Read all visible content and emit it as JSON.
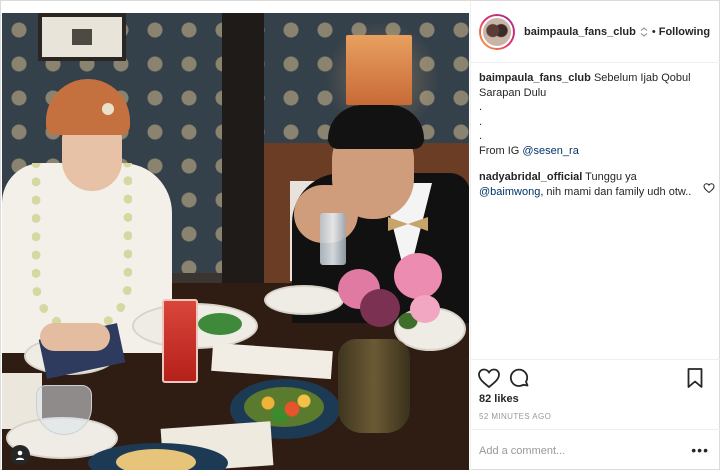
{
  "post": {
    "username": "baimpaula_fans_club",
    "header_dot": "•",
    "follow_label": "Following",
    "caption": {
      "username": "baimpaula_fans_club",
      "text": "Sebelum Ijab Qobul Sarapan Dulu",
      "dots": [
        ".",
        ".",
        "."
      ],
      "from_prefix": "From IG ",
      "from_handle": "@sesen_ra"
    },
    "comments": [
      {
        "username": "nadyabridal_official",
        "text_before": "Tunggu ya",
        "mention": "@baimwong",
        "text_after": ", nih mami dan family udh otw.."
      }
    ],
    "likes": "82 likes",
    "time": "52 MINUTES AGO",
    "add_comment_placeholder": "Add a comment...",
    "more_label": "•••"
  },
  "icons": {
    "verified": "verified-icon",
    "heart": "heart-icon",
    "comment": "comment-icon",
    "save": "bookmark-icon",
    "tag": "user-tag-icon",
    "comment_like": "heart-icon"
  },
  "colors": {
    "link": "#003569",
    "muted": "#999999",
    "text": "#262626",
    "border": "#efefef"
  }
}
